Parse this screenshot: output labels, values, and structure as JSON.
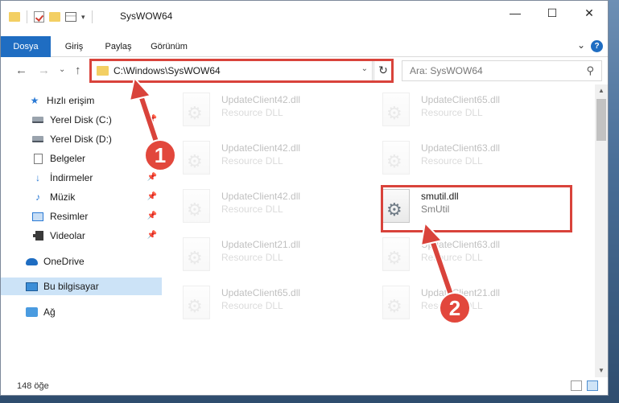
{
  "window": {
    "title": "SysWOW64",
    "controls": {
      "minimize": "—",
      "maximize": "☐",
      "close": "✕"
    }
  },
  "ribbon": {
    "tabs": [
      "Dosya",
      "Giriş",
      "Paylaş",
      "Görünüm"
    ],
    "active_tab": "Dosya",
    "help": "?"
  },
  "navigation": {
    "back": "←",
    "forward": "→",
    "recent": "⌄",
    "up": "↑"
  },
  "address_bar": {
    "path": "C:\\Windows\\SysWOW64",
    "refresh": "↻"
  },
  "search": {
    "placeholder": "Ara: SysWOW64",
    "icon": "search-icon"
  },
  "sidebar": {
    "items": [
      {
        "label": "Hızlı erişim",
        "icon": "star-icon",
        "pinned": false
      },
      {
        "label": "Yerel Disk (C:)",
        "icon": "drive-icon",
        "pinned": true
      },
      {
        "label": "Yerel Disk (D:)",
        "icon": "drive-icon",
        "pinned": false
      },
      {
        "label": "Belgeler",
        "icon": "document-icon",
        "pinned": true
      },
      {
        "label": "İndirmeler",
        "icon": "download-icon",
        "pinned": true
      },
      {
        "label": "Müzik",
        "icon": "music-icon",
        "pinned": true
      },
      {
        "label": "Resimler",
        "icon": "pictures-icon",
        "pinned": true
      },
      {
        "label": "Videolar",
        "icon": "videos-icon",
        "pinned": true
      },
      {
        "label": "OneDrive",
        "icon": "cloud-icon",
        "pinned": false
      },
      {
        "label": "Bu bilgisayar",
        "icon": "computer-icon",
        "pinned": false,
        "selected": true
      },
      {
        "label": "Ağ",
        "icon": "network-icon",
        "pinned": false
      }
    ]
  },
  "files": [
    {
      "name": "UpdateClient42.dll",
      "description": "Resource DLL"
    },
    {
      "name": "UpdateClient65.dll",
      "description": "Resource DLL"
    },
    {
      "name": "UpdateClient42.dll",
      "description": "Resource DLL"
    },
    {
      "name": "UpdateClient63.dll",
      "description": "Resource DLL"
    },
    {
      "name": "UpdateClient42.dll",
      "description": "Resource DLL"
    },
    {
      "name": "smutil.dll",
      "description": "SmUtil",
      "highlighted": true
    },
    {
      "name": "UpdateClient21.dll",
      "description": "Resource DLL"
    },
    {
      "name": "UpdateClient63.dll",
      "description": "Resource DLL"
    },
    {
      "name": "UpdateClient65.dll",
      "description": "Resource DLL"
    },
    {
      "name": "UpdateClient21.dll",
      "description": "Resource DLL"
    }
  ],
  "status": {
    "count": "148 öğe"
  },
  "annotations": {
    "step1": "1",
    "step2": "2",
    "color": "#d9433b"
  }
}
